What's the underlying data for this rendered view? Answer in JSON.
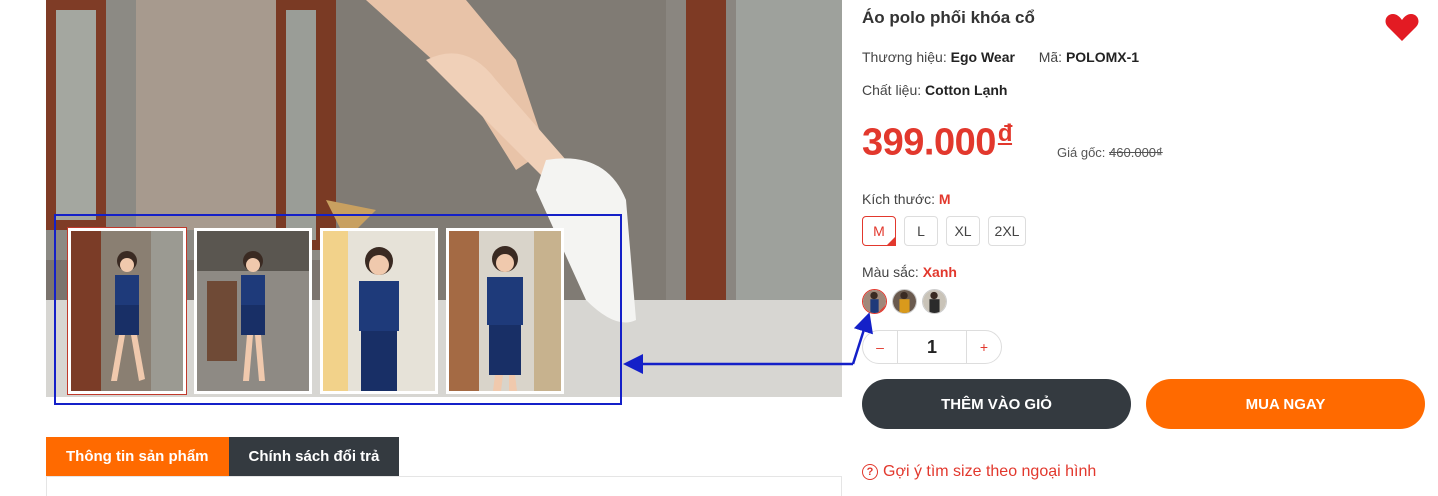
{
  "product": {
    "title": "Áo polo phối khóa cổ",
    "brand_label": "Thương hiệu:",
    "brand_value": "Ego Wear",
    "sku_label": "Mã:",
    "sku_value": "POLOMX-1",
    "material_label": "Chất liệu:",
    "material_value": "Cotton Lạnh",
    "price": "399.000",
    "currency": "đ",
    "orig_label": "Giá gốc:",
    "orig_price": "460.000₫"
  },
  "size": {
    "label": "Kích thước:",
    "selected": "M",
    "options": [
      "M",
      "L",
      "XL",
      "2XL"
    ]
  },
  "color": {
    "label": "Màu sắc:",
    "selected": "Xanh",
    "swatch_icons": [
      "navy-swatch",
      "mustard-swatch",
      "dark-swatch"
    ]
  },
  "quantity": {
    "minus": "–",
    "value": "1",
    "plus": "+"
  },
  "actions": {
    "add_to_cart": "THÊM VÀO GIỎ",
    "buy_now": "MUA NGAY"
  },
  "size_hint": {
    "icon": "?",
    "text": "Gợi ý tìm size theo ngoại hình"
  },
  "tabs": [
    "Thông tin sản phẩm",
    "Chính sách đổi trả"
  ],
  "thumbnails_count": 4,
  "colors": {
    "price": "#e2382d",
    "primary": "#ff6a00",
    "dark": "#343a40",
    "annotation": "#1420c8"
  }
}
